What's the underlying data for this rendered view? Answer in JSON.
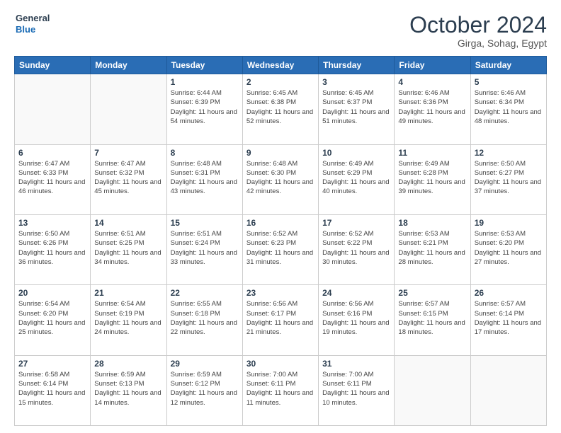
{
  "header": {
    "logo": {
      "line1": "General",
      "line2": "Blue"
    },
    "month": "October 2024",
    "location": "Girga, Sohag, Egypt"
  },
  "weekdays": [
    "Sunday",
    "Monday",
    "Tuesday",
    "Wednesday",
    "Thursday",
    "Friday",
    "Saturday"
  ],
  "weeks": [
    [
      {
        "day": null
      },
      {
        "day": null
      },
      {
        "day": 1,
        "sunrise": "6:44 AM",
        "sunset": "6:39 PM",
        "daylight": "11 hours and 54 minutes."
      },
      {
        "day": 2,
        "sunrise": "6:45 AM",
        "sunset": "6:38 PM",
        "daylight": "11 hours and 52 minutes."
      },
      {
        "day": 3,
        "sunrise": "6:45 AM",
        "sunset": "6:37 PM",
        "daylight": "11 hours and 51 minutes."
      },
      {
        "day": 4,
        "sunrise": "6:46 AM",
        "sunset": "6:36 PM",
        "daylight": "11 hours and 49 minutes."
      },
      {
        "day": 5,
        "sunrise": "6:46 AM",
        "sunset": "6:34 PM",
        "daylight": "11 hours and 48 minutes."
      }
    ],
    [
      {
        "day": 6,
        "sunrise": "6:47 AM",
        "sunset": "6:33 PM",
        "daylight": "11 hours and 46 minutes."
      },
      {
        "day": 7,
        "sunrise": "6:47 AM",
        "sunset": "6:32 PM",
        "daylight": "11 hours and 45 minutes."
      },
      {
        "day": 8,
        "sunrise": "6:48 AM",
        "sunset": "6:31 PM",
        "daylight": "11 hours and 43 minutes."
      },
      {
        "day": 9,
        "sunrise": "6:48 AM",
        "sunset": "6:30 PM",
        "daylight": "11 hours and 42 minutes."
      },
      {
        "day": 10,
        "sunrise": "6:49 AM",
        "sunset": "6:29 PM",
        "daylight": "11 hours and 40 minutes."
      },
      {
        "day": 11,
        "sunrise": "6:49 AM",
        "sunset": "6:28 PM",
        "daylight": "11 hours and 39 minutes."
      },
      {
        "day": 12,
        "sunrise": "6:50 AM",
        "sunset": "6:27 PM",
        "daylight": "11 hours and 37 minutes."
      }
    ],
    [
      {
        "day": 13,
        "sunrise": "6:50 AM",
        "sunset": "6:26 PM",
        "daylight": "11 hours and 36 minutes."
      },
      {
        "day": 14,
        "sunrise": "6:51 AM",
        "sunset": "6:25 PM",
        "daylight": "11 hours and 34 minutes."
      },
      {
        "day": 15,
        "sunrise": "6:51 AM",
        "sunset": "6:24 PM",
        "daylight": "11 hours and 33 minutes."
      },
      {
        "day": 16,
        "sunrise": "6:52 AM",
        "sunset": "6:23 PM",
        "daylight": "11 hours and 31 minutes."
      },
      {
        "day": 17,
        "sunrise": "6:52 AM",
        "sunset": "6:22 PM",
        "daylight": "11 hours and 30 minutes."
      },
      {
        "day": 18,
        "sunrise": "6:53 AM",
        "sunset": "6:21 PM",
        "daylight": "11 hours and 28 minutes."
      },
      {
        "day": 19,
        "sunrise": "6:53 AM",
        "sunset": "6:20 PM",
        "daylight": "11 hours and 27 minutes."
      }
    ],
    [
      {
        "day": 20,
        "sunrise": "6:54 AM",
        "sunset": "6:20 PM",
        "daylight": "11 hours and 25 minutes."
      },
      {
        "day": 21,
        "sunrise": "6:54 AM",
        "sunset": "6:19 PM",
        "daylight": "11 hours and 24 minutes."
      },
      {
        "day": 22,
        "sunrise": "6:55 AM",
        "sunset": "6:18 PM",
        "daylight": "11 hours and 22 minutes."
      },
      {
        "day": 23,
        "sunrise": "6:56 AM",
        "sunset": "6:17 PM",
        "daylight": "11 hours and 21 minutes."
      },
      {
        "day": 24,
        "sunrise": "6:56 AM",
        "sunset": "6:16 PM",
        "daylight": "11 hours and 19 minutes."
      },
      {
        "day": 25,
        "sunrise": "6:57 AM",
        "sunset": "6:15 PM",
        "daylight": "11 hours and 18 minutes."
      },
      {
        "day": 26,
        "sunrise": "6:57 AM",
        "sunset": "6:14 PM",
        "daylight": "11 hours and 17 minutes."
      }
    ],
    [
      {
        "day": 27,
        "sunrise": "6:58 AM",
        "sunset": "6:14 PM",
        "daylight": "11 hours and 15 minutes."
      },
      {
        "day": 28,
        "sunrise": "6:59 AM",
        "sunset": "6:13 PM",
        "daylight": "11 hours and 14 minutes."
      },
      {
        "day": 29,
        "sunrise": "6:59 AM",
        "sunset": "6:12 PM",
        "daylight": "11 hours and 12 minutes."
      },
      {
        "day": 30,
        "sunrise": "7:00 AM",
        "sunset": "6:11 PM",
        "daylight": "11 hours and 11 minutes."
      },
      {
        "day": 31,
        "sunrise": "7:00 AM",
        "sunset": "6:11 PM",
        "daylight": "11 hours and 10 minutes."
      },
      {
        "day": null
      },
      {
        "day": null
      }
    ]
  ],
  "labels": {
    "sunrise": "Sunrise:",
    "sunset": "Sunset:",
    "daylight": "Daylight:"
  }
}
